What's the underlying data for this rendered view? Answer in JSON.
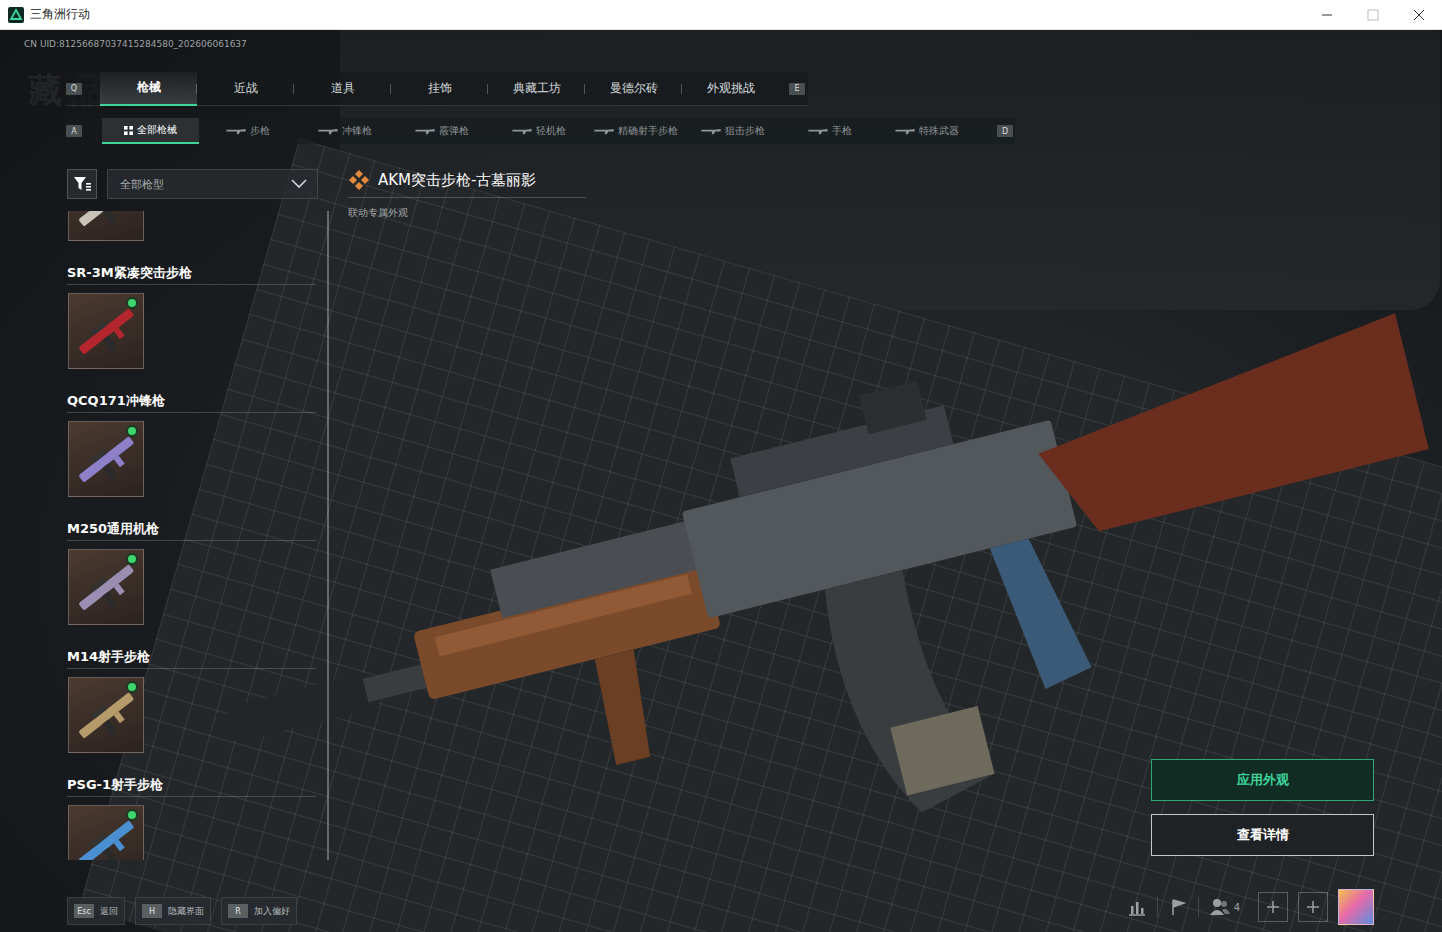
{
  "window": {
    "title": "三角洲行动"
  },
  "uid": "CN UID:81256687037415284580_202606061637",
  "watermark": "藏品",
  "main_tabs": {
    "prev_key": "Q",
    "next_key": "E",
    "tabs": [
      {
        "label": "枪械",
        "selected": true
      },
      {
        "label": "近战",
        "selected": false
      },
      {
        "label": "道具",
        "selected": false
      },
      {
        "label": "挂饰",
        "selected": false
      },
      {
        "label": "典藏工坊",
        "selected": false
      },
      {
        "label": "曼德尔砖",
        "selected": false
      },
      {
        "label": "外观挑战",
        "selected": false
      }
    ]
  },
  "sub_tabs": {
    "prev_key": "A",
    "next_key": "D",
    "tabs": [
      {
        "label": "全部枪械",
        "selected": true
      },
      {
        "label": "步枪",
        "selected": false
      },
      {
        "label": "冲锋枪",
        "selected": false
      },
      {
        "label": "霰弹枪",
        "selected": false
      },
      {
        "label": "轻机枪",
        "selected": false
      },
      {
        "label": "精确射手步枪",
        "selected": false
      },
      {
        "label": "狙击步枪",
        "selected": false
      },
      {
        "label": "手枪",
        "selected": false
      },
      {
        "label": "特殊武器",
        "selected": false
      }
    ]
  },
  "filter": {
    "value": "全部枪型"
  },
  "weapons": [
    {
      "name": "",
      "new": false,
      "color": "#c9c2b8"
    },
    {
      "name": "SR-3M紧凑突击步枪",
      "new": true,
      "color": "#b3262e"
    },
    {
      "name": "QCQ171冲锋枪",
      "new": true,
      "color": "#8e7fc9"
    },
    {
      "name": "M250通用机枪",
      "new": true,
      "color": "#9a8fb3"
    },
    {
      "name": "M14射手步枪",
      "new": true,
      "color": "#b59a6a"
    },
    {
      "name": "PSG-1射手步枪",
      "new": true,
      "color": "#4a8fd1"
    }
  ],
  "detail": {
    "title": "AKM突击步枪-古墓丽影",
    "subtitle": "联动专属外观"
  },
  "actions": [
    {
      "label": "应用外观",
      "primary": true
    },
    {
      "label": "查看详情",
      "primary": false
    }
  ],
  "hints": [
    {
      "key": "Esc",
      "label": "返回"
    },
    {
      "key": "H",
      "label": "隐藏界面"
    },
    {
      "key": "R",
      "label": "加入偏好"
    }
  ],
  "status": {
    "party_count": "4"
  }
}
